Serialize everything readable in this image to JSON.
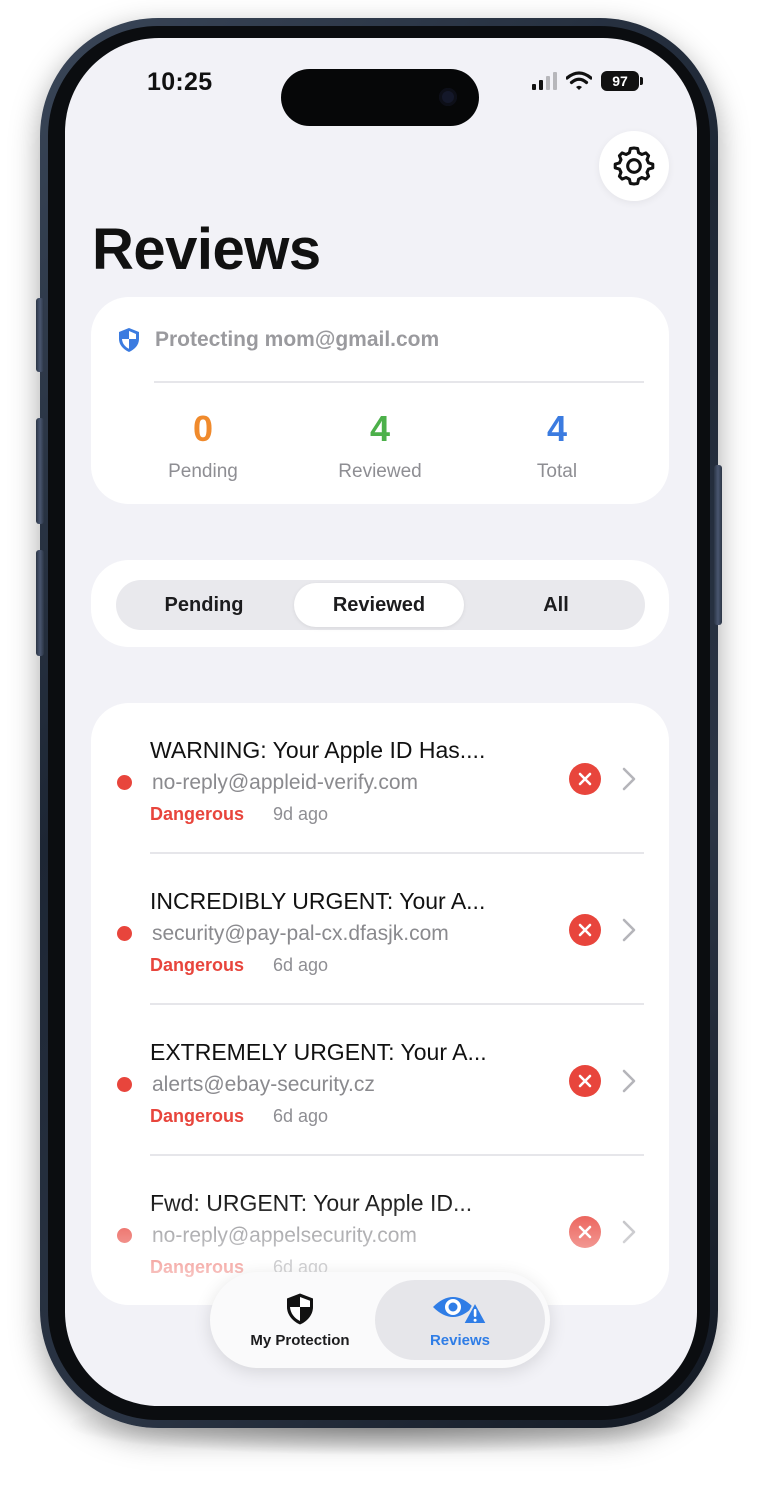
{
  "status_bar": {
    "time": "10:25",
    "battery": "97"
  },
  "header": {
    "title": "Reviews"
  },
  "protection": {
    "text": "Protecting mom@gmail.com"
  },
  "stats": [
    {
      "value": "0",
      "label": "Pending",
      "color": "#f08a2c"
    },
    {
      "value": "4",
      "label": "Reviewed",
      "color": "#4cb04a"
    },
    {
      "value": "4",
      "label": "Total",
      "color": "#3b7be0"
    }
  ],
  "segments": {
    "items": [
      "Pending",
      "Reviewed",
      "All"
    ],
    "selected": "Reviewed"
  },
  "reviews": [
    {
      "subject": "WARNING: Your Apple ID Has....",
      "sender": "no-reply@appleid-verify.com",
      "status": "Dangerous",
      "time": "9d ago"
    },
    {
      "subject": "INCREDIBLY URGENT: Your A...",
      "sender": "security@pay-pal-cx.dfasjk.com",
      "status": "Dangerous",
      "time": "6d ago"
    },
    {
      "subject": "EXTREMELY URGENT: Your A...",
      "sender": "alerts@ebay-security.cz",
      "status": "Dangerous",
      "time": "6d ago"
    },
    {
      "subject": "Fwd: URGENT: Your Apple ID...",
      "sender": "no-reply@appelsecurity.com",
      "status": "Dangerous",
      "time": "6d ago"
    }
  ],
  "tab_bar": {
    "tabs": [
      {
        "label": "My Protection",
        "icon": "shield-icon"
      },
      {
        "label": "Reviews",
        "icon": "eye-warning-icon"
      }
    ],
    "selected": "Reviews"
  },
  "colors": {
    "danger": "#e8453c",
    "accent": "#3b7be0",
    "background": "#f2f2f7"
  }
}
